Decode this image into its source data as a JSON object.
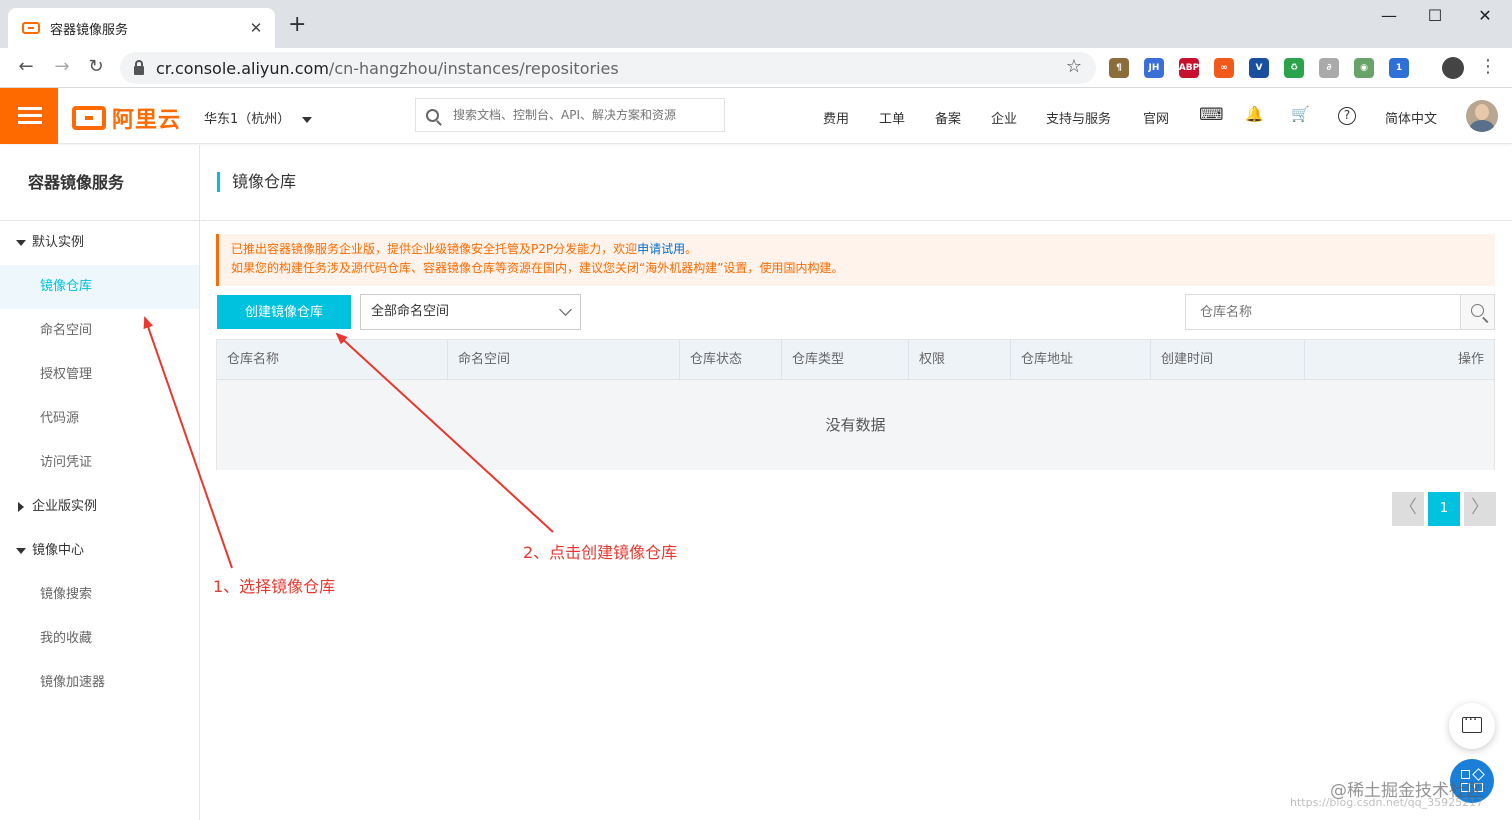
{
  "browser": {
    "tab_title": "容器镜像服务",
    "tab_close": "✕",
    "new_tab": "+",
    "url_host": "cr.console.aliyun.com",
    "url_path": "/cn-hangzhou/instances/repositories",
    "win_min": "—",
    "win_max": "☐",
    "win_close": "✕",
    "back": "←",
    "forward": "→",
    "reload": "↻",
    "star": "☆",
    "extensions": [
      {
        "label": "¶",
        "color": "#8a6d3b"
      },
      {
        "label": "JH",
        "color": "#3a6fd8"
      },
      {
        "label": "ABP",
        "color": "#c8102e"
      },
      {
        "label": "∞",
        "color": "#f25a1d"
      },
      {
        "label": "V",
        "color": "#1a4fa0"
      },
      {
        "label": "♻",
        "color": "#2aa34a"
      },
      {
        "label": "∂",
        "color": "#aaaaaa"
      },
      {
        "label": "◉",
        "color": "#6aa36a"
      },
      {
        "label": "1",
        "color": "#2e6fd8"
      }
    ],
    "menu_dots": "⋮"
  },
  "header": {
    "logo_text": "阿里云",
    "region": "华东1（杭州）",
    "search_placeholder": "搜索文档、控制台、API、解决方案和资源",
    "links": [
      "费用",
      "工单",
      "备案",
      "企业",
      "支持与服务",
      "官网"
    ],
    "icons": {
      "terminal": "⌨",
      "bell": "🔔",
      "cart": "🛒",
      "help": "?"
    },
    "language": "简体中文"
  },
  "sidebar": {
    "title": "容器镜像服务",
    "group_default": "默认实例",
    "items_default": [
      "镜像仓库",
      "命名空间",
      "授权管理",
      "代码源",
      "访问凭证"
    ],
    "group_enterprise": "企业版实例",
    "group_center": "镜像中心",
    "items_center": [
      "镜像搜索",
      "我的收藏",
      "镜像加速器"
    ]
  },
  "main": {
    "page_title": "镜像仓库",
    "notice_line1": "已推出容器镜像服务企业版，提供企业级镜像安全托管及P2P分发能力，欢迎",
    "notice_link": "申请试用",
    "notice_line1_end": "。",
    "notice_line2": "如果您的构建任务涉及源代码仓库、容器镜像仓库等资源在国内，建议您关闭“海外机器构建”设置，使用国内构建。",
    "create_button": "创建镜像仓库",
    "namespace_select": "全部命名空间",
    "repo_search_placeholder": "仓库名称",
    "columns": [
      "仓库名称",
      "命名空间",
      "仓库状态",
      "仓库类型",
      "权限",
      "仓库地址",
      "创建时间",
      "操作"
    ],
    "empty_text": "没有数据",
    "pager_prev": "〈",
    "pager_page": "1",
    "pager_next": "〉"
  },
  "annotations": {
    "step1": "1、选择镜像仓库",
    "step2": "2、点击创建镜像仓库",
    "color": "#e8382f"
  },
  "watermark": {
    "text": "@稀土掘金技术社区",
    "url": "https://blog.csdn.net/qq_35925217"
  }
}
